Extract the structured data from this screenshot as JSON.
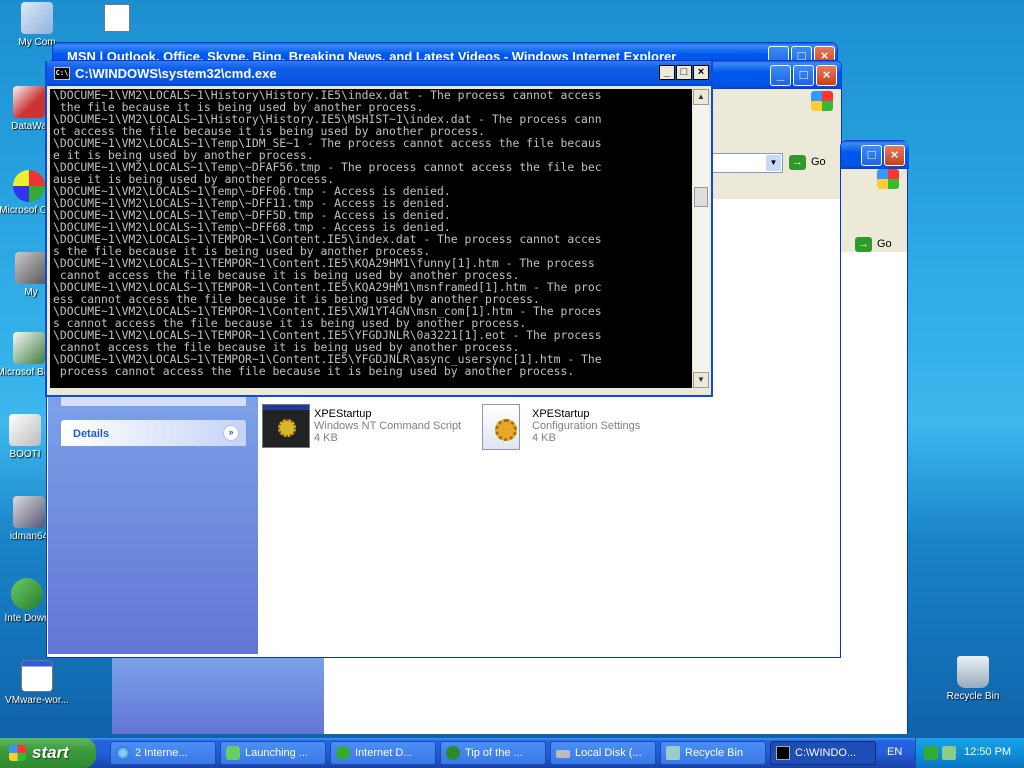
{
  "desktop": {
    "icons": [
      "My Com",
      "DataWa",
      "Microsof C++",
      "My",
      "Microsof Basic",
      "BOOTI",
      "idman64",
      "Inte Down",
      "VMware-wor...",
      "Recycle Bin"
    ]
  },
  "windows": {
    "ie_back_title": "MSN | Outlook, Office, Skype, Bing, Breaking News, and Latest Videos - Windows Internet Explorer",
    "go_label": "Go"
  },
  "cmd": {
    "title": "C:\\WINDOWS\\system32\\cmd.exe",
    "icon_text": "C:\\",
    "lines": [
      "\\DOCUME~1\\VM2\\LOCALS~1\\History\\History.IE5\\index.dat - The process cannot access",
      " the file because it is being used by another process.",
      "\\DOCUME~1\\VM2\\LOCALS~1\\History\\History.IE5\\MSHIST~1\\index.dat - The process cann",
      "ot access the file because it is being used by another process.",
      "\\DOCUME~1\\VM2\\LOCALS~1\\Temp\\IDM_SE~1 - The process cannot access the file becaus",
      "e it is being used by another process.",
      "\\DOCUME~1\\VM2\\LOCALS~1\\Temp\\~DFAF56.tmp - The process cannot access the file bec",
      "ause it is being used by another process.",
      "\\DOCUME~1\\VM2\\LOCALS~1\\Temp\\~DFF06.tmp - Access is denied.",
      "\\DOCUME~1\\VM2\\LOCALS~1\\Temp\\~DFF11.tmp - Access is denied.",
      "\\DOCUME~1\\VM2\\LOCALS~1\\Temp\\~DFF5D.tmp - Access is denied.",
      "\\DOCUME~1\\VM2\\LOCALS~1\\Temp\\~DFF68.tmp - Access is denied.",
      "\\DOCUME~1\\VM2\\LOCALS~1\\TEMPOR~1\\Content.IE5\\index.dat - The process cannot acces",
      "s the file because it is being used by another process.",
      "\\DOCUME~1\\VM2\\LOCALS~1\\TEMPOR~1\\Content.IE5\\KQA29HM1\\funny[1].htm - The process",
      " cannot access the file because it is being used by another process.",
      "\\DOCUME~1\\VM2\\LOCALS~1\\TEMPOR~1\\Content.IE5\\KQA29HM1\\msnframed[1].htm - The proc",
      "ess cannot access the file because it is being used by another process.",
      "\\DOCUME~1\\VM2\\LOCALS~1\\TEMPOR~1\\Content.IE5\\XW1YT4GN\\msn_com[1].htm - The proces",
      "s cannot access the file because it is being used by another process.",
      "\\DOCUME~1\\VM2\\LOCALS~1\\TEMPOR~1\\Content.IE5\\YFGDJNLR\\0a3221[1].eot - The process",
      " cannot access the file because it is being used by another process.",
      "\\DOCUME~1\\VM2\\LOCALS~1\\TEMPOR~1\\Content.IE5\\YFGDJNLR\\async_usersync[1].htm - The",
      " process cannot access the file because it is being used by another process."
    ]
  },
  "explorer": {
    "details_label": "Details",
    "files": [
      {
        "name": "XPEStartup",
        "type": "Windows NT Command Script",
        "size": "4 KB",
        "icon": "batch-file-icon"
      },
      {
        "name": "XPEStartup",
        "type": "Configuration Settings",
        "size": "4 KB",
        "icon": "config-file-icon"
      }
    ]
  },
  "taskbar": {
    "start_label": "start",
    "tasks": [
      {
        "label": "2 Interne...",
        "icon": "ie-icon"
      },
      {
        "label": "Launching ...",
        "icon": "launch-icon"
      },
      {
        "label": "Internet D...",
        "icon": "idm-icon"
      },
      {
        "label": "Tip of the ...",
        "icon": "tip-icon"
      },
      {
        "label": "Local Disk (...",
        "icon": "drive-icon"
      },
      {
        "label": "Recycle Bin",
        "icon": "recycle-icon"
      },
      {
        "label": "C:\\WINDO...",
        "icon": "cmd-icon"
      }
    ],
    "language": "EN",
    "clock": "12:50 PM"
  },
  "colors": {
    "xp_blue": "#0055e5",
    "console_bg": "#000000",
    "console_fg": "#c0c0c0",
    "start_green": "#3c9a3c"
  }
}
